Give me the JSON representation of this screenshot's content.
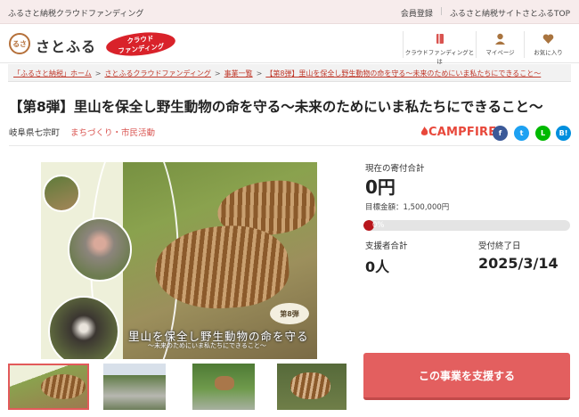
{
  "topbar": {
    "tagline": "ふるさと納税クラウドファンディング",
    "member_register": "会員登録",
    "site_top": "ふるさと納税サイトさとふるTOP"
  },
  "header": {
    "logo_mark": "るさ",
    "logo_text": "さとふる",
    "badge_line1": "クラウド",
    "badge_line2": "ファンディング",
    "nav": [
      {
        "label": "クラウドファンディングとは",
        "icon": "book-icon"
      },
      {
        "label": "マイページ",
        "icon": "person-icon"
      },
      {
        "label": "お気に入り",
        "icon": "heart-icon"
      }
    ]
  },
  "breadcrumb": {
    "items": [
      "「ふるさと納税」ホーム",
      "さとふるクラウドファンディング",
      "事業一覧",
      "【第8弾】里山を保全し野生動物の命を守る～未来のためにいま私たちにできること～"
    ]
  },
  "project": {
    "title": "【第8弾】里山を保全し野生動物の命を守る～未来のためにいま私たちにできること～",
    "location": "岐阜県七宗町",
    "category": "まちづくり・市民活動",
    "partner": "CAMPFIRE",
    "share": [
      {
        "name": "facebook",
        "glyph": "f",
        "color": "#3b5998"
      },
      {
        "name": "twitter",
        "glyph": "t",
        "color": "#1da1f2"
      },
      {
        "name": "line",
        "glyph": "L",
        "color": "#00b900"
      },
      {
        "name": "hatena",
        "glyph": "B!",
        "color": "#008fde"
      }
    ]
  },
  "hero": {
    "badge": "第8弾",
    "line1": "里山を保全し野生動物の命を守る",
    "line2": "～未来のためにいま私たちにできること～"
  },
  "stats": {
    "current_label": "現在の寄付合計",
    "current_value": "0円",
    "goal_label": "目標金額：1,500,000円",
    "progress_text": "0%",
    "progress_fraction": 0,
    "supporters_label": "支援者合計",
    "supporters_value": "0人",
    "deadline_label": "受付終了日",
    "deadline_value": "2025/3/14"
  },
  "cta": {
    "label": "この事業を支援する"
  }
}
